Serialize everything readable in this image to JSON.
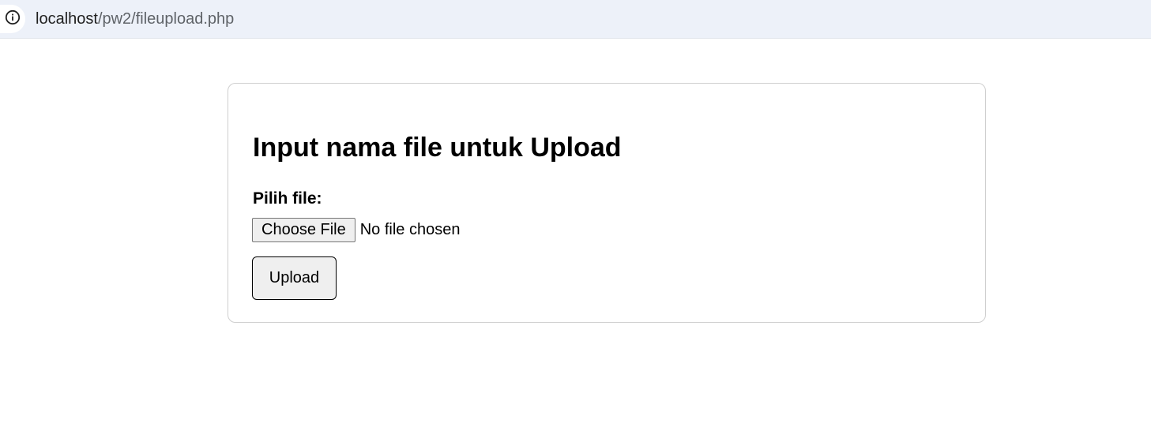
{
  "browser": {
    "url_host": "localhost",
    "url_path": "/pw2/fileupload.php",
    "icon": "info-icon"
  },
  "form": {
    "title": "Input nama file untuk Upload",
    "file_label": "Pilih file:",
    "choose_file_label": "Choose File",
    "file_status": "No file chosen",
    "upload_label": "Upload"
  },
  "colors": {
    "address_bar_bg": "#edf1f9",
    "button_bg": "#efefef",
    "card_border": "#cfcfcf"
  }
}
